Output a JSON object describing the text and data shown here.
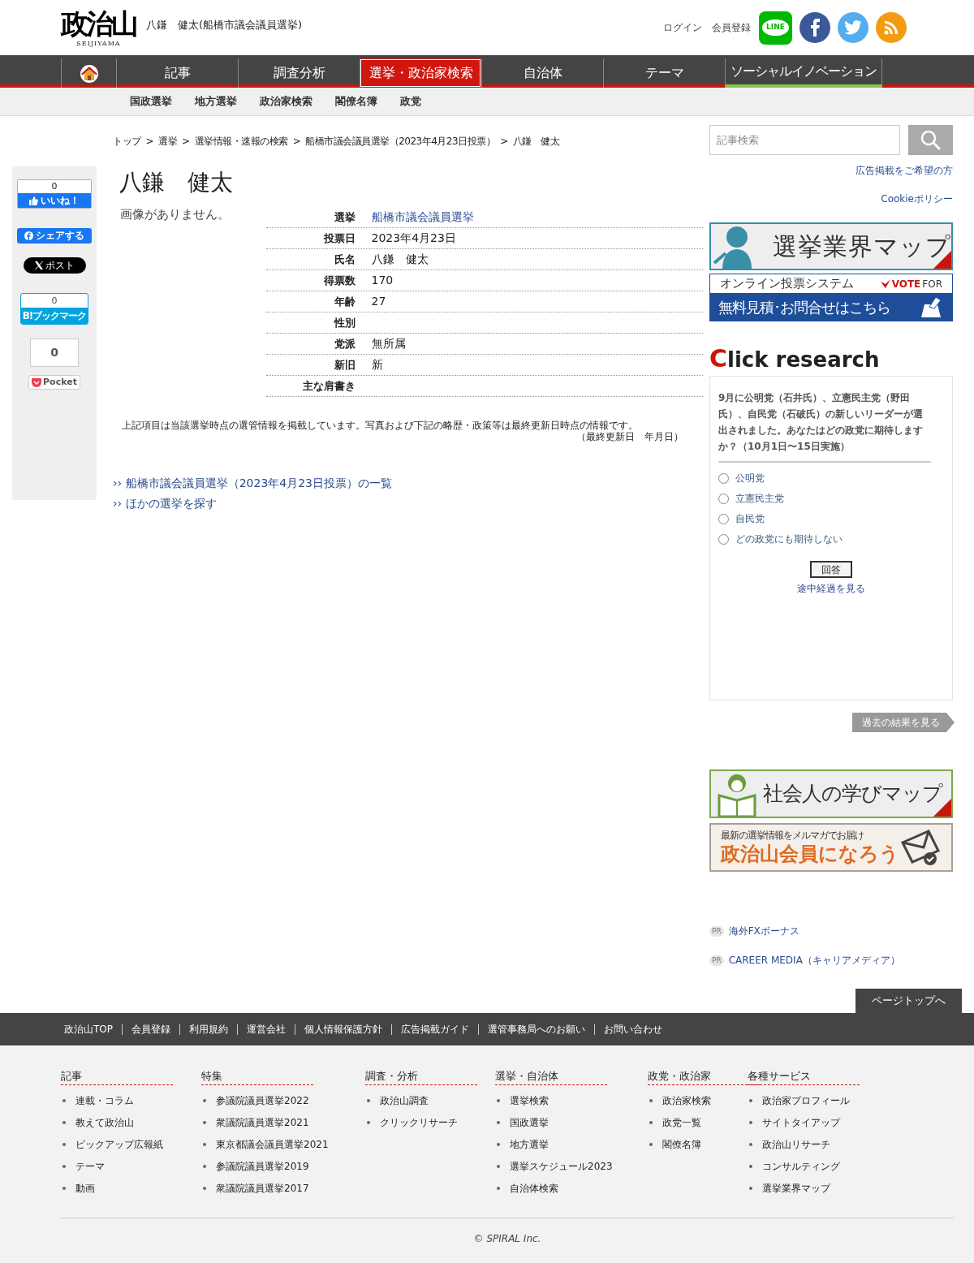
{
  "header": {
    "logo": "政治山",
    "logo_sub": "SEIJIYAMA",
    "page_title": "八鎌　健太(船橋市議会議員選挙)",
    "links": [
      "ログイン",
      "会員登録"
    ],
    "social": [
      {
        "kind": "line",
        "label": "LINE"
      },
      {
        "kind": "facebook"
      },
      {
        "kind": "twitter"
      },
      {
        "kind": "rss"
      }
    ]
  },
  "nav": [
    {
      "kind": "home",
      "selected": false
    },
    {
      "kind": "text",
      "label": "記事",
      "selected": false
    },
    {
      "kind": "text",
      "label": "調査分析",
      "selected": false
    },
    {
      "kind": "text",
      "label": "選挙・政治家検索",
      "selected": true
    },
    {
      "kind": "text",
      "label": "自治体",
      "selected": false
    },
    {
      "kind": "text",
      "label": "テーマ",
      "selected": false
    },
    {
      "kind": "feature",
      "label": "ソーシャルイノベーション",
      "selected": false
    }
  ],
  "subnav": [
    "国政選挙",
    "地方選挙",
    "政治家検索",
    "閣僚名簿",
    "政党"
  ],
  "breadcrumb": [
    "トップ",
    "選挙",
    "選挙情報・速報の検索",
    "船橋市議会議員選挙（2023年4月23日投票）",
    "八鎌　健太"
  ],
  "breadcrumb_separator": ">",
  "share": {
    "like_count": "0",
    "like_label": "いいね！",
    "share_label": "シェアする",
    "post_label": "ポスト",
    "hatena_count": "0",
    "hatena_label": "B!ブックマーク",
    "pocket_count": "0",
    "pocket_label": "Pocket"
  },
  "profile": {
    "name": "八鎌　健太",
    "no_image": "画像がありません。",
    "rows": [
      {
        "label": "選挙",
        "value": "船橋市議会議員選挙",
        "kind": "link"
      },
      {
        "label": "投票日",
        "value": "2023年4月23日",
        "kind": "text"
      },
      {
        "label": "氏名",
        "value": "八鎌　健太",
        "kind": "text"
      },
      {
        "label": "得票数",
        "value": "170",
        "kind": "text"
      },
      {
        "label": "年齢",
        "value": "27",
        "kind": "text"
      },
      {
        "label": "性別",
        "kind": "text"
      },
      {
        "label": "党派",
        "value": "無所属",
        "kind": "text"
      },
      {
        "label": "新旧",
        "value": "新",
        "kind": "text"
      },
      {
        "label": "主な肩書き",
        "kind": "text"
      }
    ],
    "note": "上記項目は当該選挙時点の選管情報を掲載しています。写真および下記の略歴・政策等は最終更新日時点の情報です。",
    "updated": "（最終更新日　年月日）",
    "links": [
      {
        "marker": "››",
        "label": "船橋市議会議員選挙（2023年4月23日投票）の一覧"
      },
      {
        "marker": "››",
        "label": "ほかの選挙を探す"
      }
    ]
  },
  "sidebar": {
    "search_placeholder": "記事検索",
    "links": [
      "広告掲載をご希望の方",
      "Cookieポリシー"
    ],
    "map_banner": "選挙業界マップ",
    "vote_banner": {
      "top": "オンライン投票システム",
      "brand_bold": "VOTE",
      "brand_light": "FOR",
      "bottom": "無料見積･お問合せはこちら"
    },
    "research": {
      "initial": "C",
      "rest": "lick research",
      "question": "9月に公明党（石井氏）、立憲民主党（野田氏）、自民党（石破氏）の新しいリーダーが選出されました。あなたはどの政党に期待しますか？（10月1日〜15日実施）",
      "options": [
        {
          "label": "公明党",
          "selected": false
        },
        {
          "label": "立憲民主党",
          "selected": false
        },
        {
          "label": "自民党",
          "selected": false
        },
        {
          "label": "どの政党にも期待しない",
          "selected": false
        }
      ],
      "submit": "回答",
      "progress": "途中経過を見る",
      "past": "過去の結果を見る"
    },
    "learn_banner": "社会人の学びマップ",
    "member_banner": {
      "top": "最新の選挙情報をメルマガでお届け",
      "main": "政治山会員になろう"
    },
    "pr": [
      {
        "badge": "PR",
        "label": "海外FXボーナス"
      },
      {
        "badge": "PR",
        "label": "CAREER MEDIA（キャリアメディア）"
      }
    ]
  },
  "page_top": "ページトップへ",
  "footer": {
    "links": [
      "政治山TOP",
      "会員登録",
      "利用規約",
      "運営会社",
      "個人情報保護方針",
      "広告掲載ガイド",
      "選管事務局へのお願い",
      "お問い合わせ"
    ],
    "columns": [
      {
        "title": "記事",
        "items": [
          "連載・コラム",
          "教えて政治山",
          "ピックアップ広報紙",
          "テーマ",
          "動画"
        ]
      },
      {
        "title": "特集",
        "items": [
          "参議院議員選挙2022",
          "衆議院議員選挙2021",
          "東京都議会議員選挙2021",
          "参議院議員選挙2019",
          "衆議院議員選挙2017"
        ]
      },
      {
        "title": "調査・分析",
        "items": [
          "政治山調査",
          "クリックリサーチ"
        ]
      },
      {
        "title": "選挙・自治体",
        "items": [
          "選挙検索",
          "国政選挙",
          "地方選挙",
          "選挙スケジュール2023",
          "自治体検索"
        ]
      },
      {
        "title": "政党・政治家",
        "items": [
          "政治家検索",
          "政党一覧",
          "閣僚名簿"
        ]
      },
      {
        "title": "各種サービス",
        "items": [
          "政治家プロフィール",
          "サイトタイアップ",
          "政治山リサーチ",
          "コンサルティング",
          "選挙業界マップ"
        ]
      }
    ],
    "copyright": "© SPIRAL Inc."
  }
}
